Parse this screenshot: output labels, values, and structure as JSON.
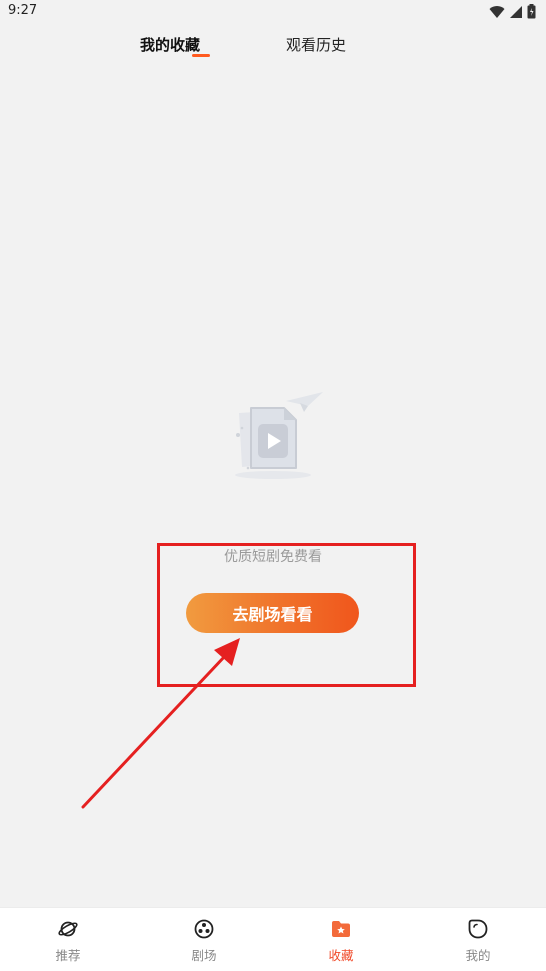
{
  "status_bar": {
    "time": "9:27",
    "icons": [
      "wifi-icon",
      "signal-icon",
      "battery-icon"
    ]
  },
  "tabs": {
    "favorites": "我的收藏",
    "history": "观看历史",
    "active": "favorites"
  },
  "empty_state": {
    "illustration": "video-file-icon",
    "message": "优质短剧免费看",
    "button_label": "去剧场看看"
  },
  "bottom_nav": {
    "items": [
      {
        "label": "推荐",
        "icon": "planet-icon"
      },
      {
        "label": "剧场",
        "icon": "film-reel-icon"
      },
      {
        "label": "收藏",
        "icon": "folder-star-icon"
      },
      {
        "label": "我的",
        "icon": "profile-icon"
      }
    ],
    "active_index": 2
  },
  "colors": {
    "accent": "#f0561c",
    "button_gradient_start": "#f19b3f",
    "button_gradient_end": "#f0561c",
    "annotation_red": "#e52020",
    "background": "#f2f2f2"
  }
}
